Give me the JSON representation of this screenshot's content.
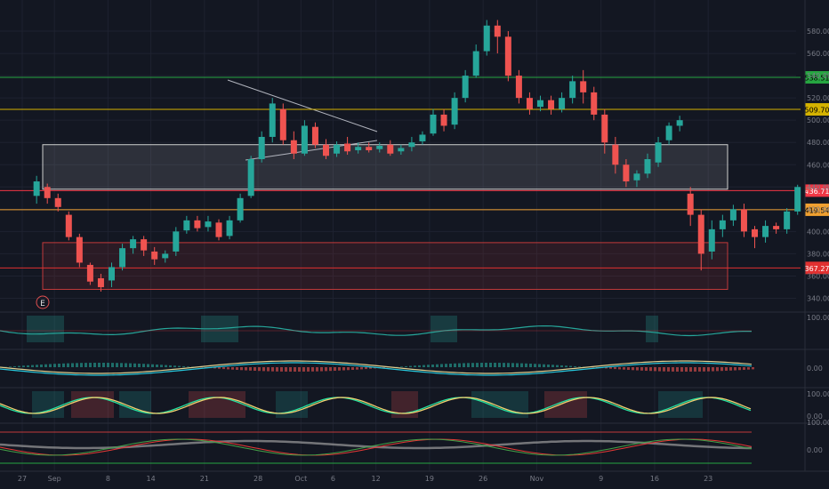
{
  "chart_data": {
    "type": "candlestick",
    "y_range": [
      330,
      600
    ],
    "price_ticks": [
      "580.00",
      "560.00",
      "540.00",
      "520.00",
      "500.00",
      "480.00",
      "460.00",
      "440.00",
      "420.00",
      "400.00",
      "380.00",
      "360.00",
      "340.00"
    ],
    "price_tick_values": [
      580,
      560,
      540,
      520,
      500,
      480,
      460,
      440,
      420,
      400,
      380,
      360,
      340
    ],
    "date_ticks": [
      {
        "label": "27",
        "i": 0
      },
      {
        "label": "Sep",
        "i": 3
      },
      {
        "label": "8",
        "i": 8
      },
      {
        "label": "14",
        "i": 12
      },
      {
        "label": "21",
        "i": 17
      },
      {
        "label": "28",
        "i": 22
      },
      {
        "label": "Oct",
        "i": 26
      },
      {
        "label": "6",
        "i": 29
      },
      {
        "label": "12",
        "i": 33
      },
      {
        "label": "19",
        "i": 38
      },
      {
        "label": "26",
        "i": 43
      },
      {
        "label": "Nov",
        "i": 48
      },
      {
        "label": "9",
        "i": 54
      },
      {
        "label": "16",
        "i": 59
      },
      {
        "label": "23",
        "i": 64
      }
    ],
    "candles": [
      [
        null,
        null,
        null,
        null
      ],
      [
        null,
        null,
        null,
        null
      ],
      [
        null,
        null,
        null,
        null
      ],
      [
        432,
        445,
        425,
        450
      ],
      [
        440,
        430,
        425,
        443
      ],
      [
        430,
        422,
        418,
        434
      ],
      [
        415,
        395,
        392,
        418
      ],
      [
        395,
        372,
        368,
        398
      ],
      [
        370,
        355,
        352,
        372
      ],
      [
        358,
        350,
        346,
        362
      ],
      [
        356,
        368,
        350,
        372
      ],
      [
        368,
        385,
        365,
        389
      ],
      [
        385,
        393,
        380,
        396
      ],
      [
        393,
        383,
        378,
        396
      ],
      [
        382,
        375,
        370,
        386
      ],
      [
        376,
        380,
        372,
        383
      ],
      [
        382,
        400,
        378,
        404
      ],
      [
        401,
        410,
        398,
        414
      ],
      [
        410,
        403,
        400,
        414
      ],
      [
        404,
        409,
        400,
        414
      ],
      [
        408,
        395,
        392,
        411
      ],
      [
        396,
        410,
        393,
        414
      ],
      [
        410,
        430,
        408,
        434
      ],
      [
        432,
        465,
        430,
        468
      ],
      [
        465,
        485,
        462,
        490
      ],
      [
        485,
        515,
        480,
        520
      ],
      [
        510,
        482,
        478,
        515
      ],
      [
        482,
        470,
        465,
        490
      ],
      [
        470,
        495,
        468,
        500
      ],
      [
        494,
        478,
        475,
        498
      ],
      [
        478,
        468,
        465,
        483
      ],
      [
        470,
        478,
        467,
        481
      ],
      [
        479,
        472,
        469,
        485
      ],
      [
        473,
        476,
        470,
        480
      ],
      [
        476,
        473,
        471,
        480
      ],
      [
        474,
        477,
        471,
        480
      ],
      [
        478,
        470,
        468,
        482
      ],
      [
        472,
        475,
        469,
        478
      ],
      [
        476,
        480,
        472,
        485
      ],
      [
        481,
        487,
        478,
        490
      ],
      [
        488,
        505,
        486,
        510
      ],
      [
        505,
        495,
        490,
        510
      ],
      [
        496,
        520,
        492,
        525
      ],
      [
        520,
        540,
        516,
        545
      ],
      [
        540,
        562,
        538,
        568
      ],
      [
        562,
        585,
        558,
        590
      ],
      [
        585,
        575,
        560,
        590
      ],
      [
        575,
        540,
        535,
        580
      ],
      [
        540,
        520,
        515,
        545
      ],
      [
        520,
        510,
        505,
        525
      ],
      [
        512,
        518,
        508,
        522
      ],
      [
        518,
        510,
        505,
        522
      ],
      [
        510,
        520,
        507,
        525
      ],
      [
        520,
        535,
        515,
        540
      ],
      [
        535,
        525,
        515,
        545
      ],
      [
        525,
        505,
        500,
        530
      ],
      [
        505,
        480,
        470,
        510
      ],
      [
        478,
        460,
        452,
        485
      ],
      [
        460,
        445,
        440,
        465
      ],
      [
        446,
        452,
        440,
        455
      ],
      [
        452,
        465,
        448,
        470
      ],
      [
        462,
        480,
        458,
        485
      ],
      [
        482,
        495,
        478,
        498
      ],
      [
        495,
        500,
        490,
        504
      ],
      [
        434,
        415,
        405,
        440
      ],
      [
        415,
        380,
        365,
        420
      ],
      [
        382,
        402,
        375,
        410
      ],
      [
        402,
        410,
        395,
        415
      ],
      [
        410,
        420,
        405,
        424
      ],
      [
        420,
        400,
        395,
        425
      ],
      [
        402,
        395,
        385,
        405
      ],
      [
        395,
        405,
        390,
        410
      ],
      [
        405,
        402,
        398,
        408
      ],
      [
        402,
        418,
        398,
        421
      ],
      [
        418,
        440,
        415,
        442
      ],
      [
        440,
        437,
        433,
        442
      ]
    ],
    "horizontal_levels": [
      {
        "value": 538.51,
        "label": "538.51",
        "color": "#26a641",
        "text_color": "#000000"
      },
      {
        "value": 509.7,
        "label": "509.70",
        "color": "#d4b200",
        "text_color": "#000000"
      },
      {
        "value": 436.71,
        "label": "436.71",
        "color": "#f23645",
        "text_color": "#ffffff"
      },
      {
        "value": 419.54,
        "label": "419.54",
        "color": "#f0a030",
        "text_color": "#000000"
      },
      {
        "value": 367.27,
        "label": "367.27",
        "color": "#e03030",
        "text_color": "#ffffff"
      }
    ],
    "zones": [
      {
        "top": 478,
        "bottom": 438,
        "color": "#cfcfcf"
      },
      {
        "top": 390,
        "bottom": 348,
        "color": "#c23a3a"
      }
    ],
    "indicators": {
      "panel1_labels": [
        "100.00"
      ],
      "panel2_labels": [
        "0.00"
      ],
      "panel3_labels": [
        "100.00",
        "0.00"
      ],
      "panel4_labels": [
        "100.00",
        "0.00"
      ]
    },
    "earnings_marker": "E",
    "colors": {
      "up": "#26a69a",
      "down": "#ef5350",
      "flat": "#f0d89a",
      "background": "#131722"
    }
  }
}
